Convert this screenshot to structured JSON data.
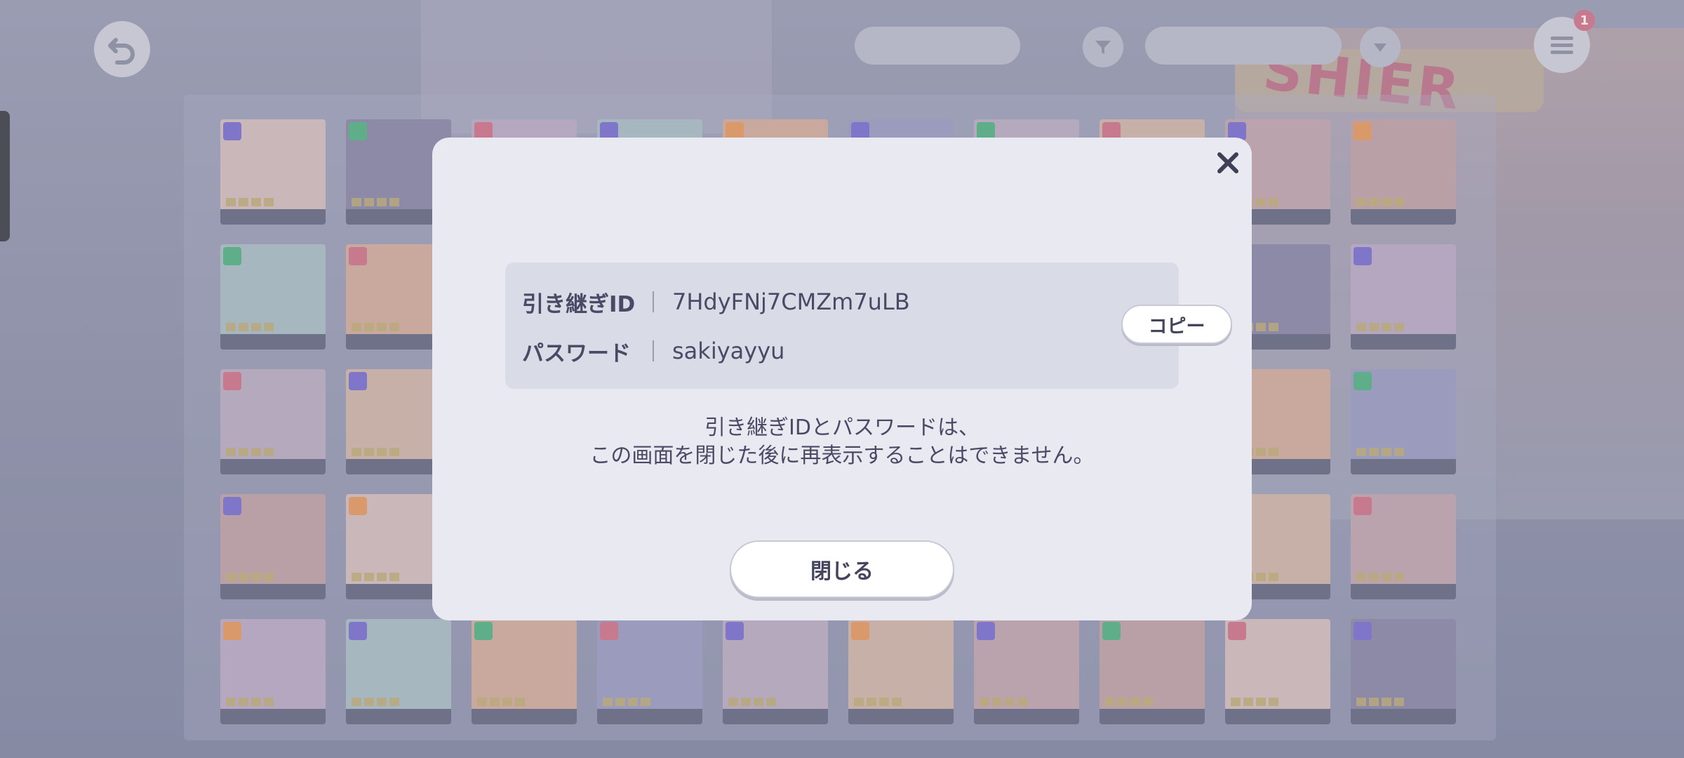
{
  "header": {
    "back_icon": "back-arrow-icon",
    "sort_label": "",
    "filter_icon": "filter-icon",
    "rarity_label": "",
    "order_icon": "chevron-down-icon",
    "menu_icon": "hamburger-menu-icon",
    "menu_badge": "1"
  },
  "background": {
    "shop_sign_text": "SHIER"
  },
  "dialog": {
    "close_icon": "close-x-icon",
    "transfer_id_label": "引き継ぎID",
    "transfer_id_value": "7HdyFNj7CMZm7uLB",
    "password_label": "パスワード",
    "password_value": "sakiyayyu",
    "copy_button": "コピー",
    "notice_line1": "引き継ぎIDとパスワードは、",
    "notice_line2": "この画面を閉じた後に再表示することはできません。",
    "close_button": "閉じる"
  },
  "colors": {
    "overlay": "#8e91a8",
    "dialog_bg": "#e8e9f1",
    "cred_box_bg": "#d9dbe6",
    "text_primary": "#4a4a66",
    "button_bg": "#ffffff"
  }
}
